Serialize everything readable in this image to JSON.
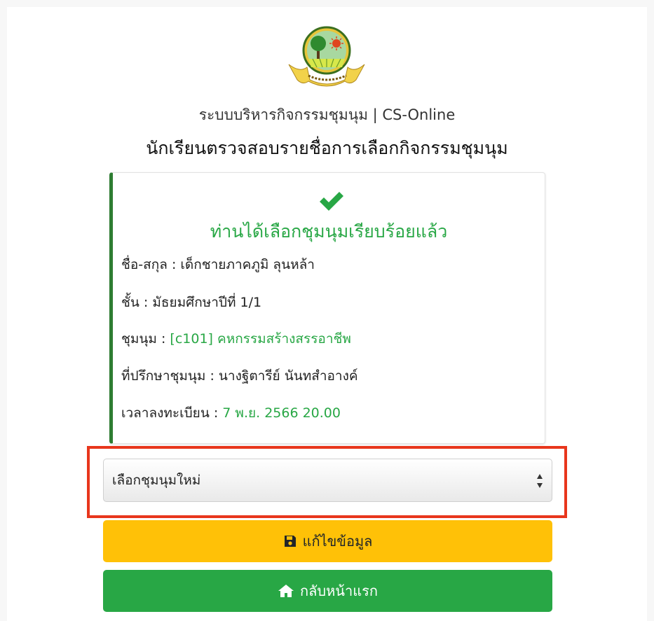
{
  "header": {
    "system_title": "ระบบบริหารกิจกรรมชุมนุม | CS-Online",
    "page_title": "นักเรียนตรวจสอบรายชื่อการเลือกกิจกรรมชุมนุม"
  },
  "card": {
    "success_message": "ท่านได้เลือกชุมนุมเรียบร้อยแล้ว",
    "name_label": "ชื่อ-สกุล :",
    "name_value": "เด็กชายภาคภูมิ ลุนหล้า",
    "class_label": "ชั้น :",
    "class_value": "มัธยมศึกษาปีที่ 1/1",
    "club_label": "ชุมนุม :",
    "club_value": "[c101] คหกรรมสร้างสรรอาชีพ",
    "advisor_label": "ที่ปรึกษาชุมนุม :",
    "advisor_value": "นางฐิตารีย์ นันทสำอางค์",
    "registered_label": "เวลาลงทะเบียน :",
    "registered_value": "7 พ.ย. 2566 20.00"
  },
  "form": {
    "select_club_selected": "เลือกชุมนุมใหม่",
    "edit_button_label": "แก้ไขข้อมูล",
    "home_button_label": "กลับหน้าแรก"
  },
  "colors": {
    "success_green": "#28a745",
    "card_border_green": "#2e7d32",
    "edit_yellow": "#ffc107",
    "highlight_red": "#e8361c"
  },
  "icons": {
    "logo": "school-emblem-logo",
    "check": "check-icon",
    "save": "save-icon",
    "home": "home-icon",
    "select_arrows": "select-arrows-icon"
  }
}
